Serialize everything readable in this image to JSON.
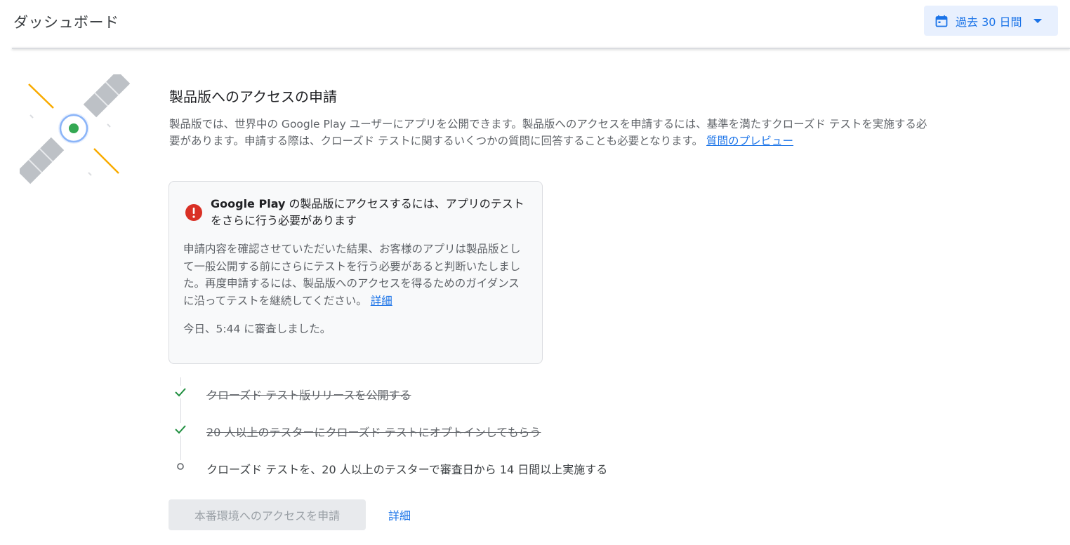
{
  "header": {
    "title": "ダッシュボード",
    "date_range_label": "過去 30 日間"
  },
  "main": {
    "section_title": "製品版へのアクセスの申請",
    "description": "製品版では、世界中の Google Play ユーザーにアプリを公開できます。製品版へのアクセスを申請するには、基準を満たすクローズド テストを実施する必要があります。申請する際は、クローズド テストに関するいくつかの質問に回答することも必要となります。",
    "preview_link": "質問のプレビュー"
  },
  "warning": {
    "heading_brand": "Google Play",
    "heading_rest": " の製品版にアクセスするには、アプリのテストをさらに行う必要があります",
    "body": "申請内容を確認させていただいた結果、お客様のアプリは製品版として一般公開する前にさらにテストを行う必要があると判断いたしました。再度申請するには、製品版へのアクセスを得るためのガイダンスに沿ってテストを継続してください。",
    "details_link": "詳細",
    "reviewed_at": "今日、5:44 に審査しました。"
  },
  "steps": [
    {
      "label": "クローズド テスト版リリースを公開する",
      "status": "done"
    },
    {
      "label": "20 人以上のテスターにクローズド テストにオプトインしてもらう",
      "status": "done"
    },
    {
      "label": "クローズド テストを、20 人以上のテスターで審査日から 14 日間以上実施する",
      "status": "pending"
    }
  ],
  "footer": {
    "request_button": "本番環境へのアクセスを申請",
    "details_link": "詳細"
  },
  "colors": {
    "accent": "#1a73e8",
    "error": "#d93025",
    "success": "#1e8e3e"
  },
  "icons": {
    "calendar": "calendar-icon",
    "dropdown": "chevron-down-icon",
    "error": "error-icon",
    "check": "check-icon",
    "pending": "circle-icon",
    "illustration": "satellite-illustration"
  }
}
